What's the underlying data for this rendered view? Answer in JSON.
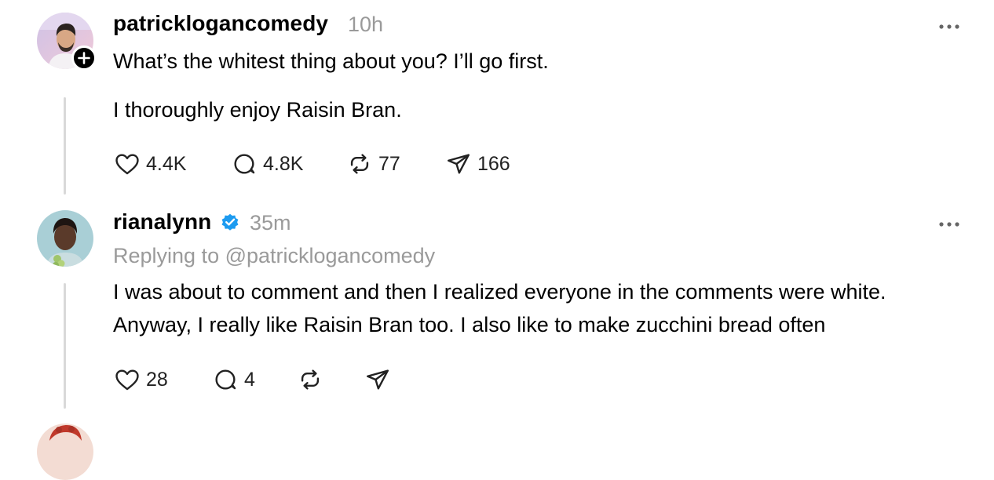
{
  "posts": [
    {
      "username": "patricklogancomedy",
      "time": "10h",
      "verified": false,
      "lines": [
        "What’s the whitest thing about you? I’ll go first.",
        "I thoroughly enjoy Raisin Bran."
      ],
      "actions": {
        "likes": "4.4K",
        "replies": "4.8K",
        "reposts": "77",
        "shares": "166"
      }
    },
    {
      "username": "rianalynn",
      "time": "35m",
      "verified": true,
      "reply_to": "Replying to @patricklogancomedy",
      "lines": [
        "I was about to comment and then I realized everyone in the comments were white.",
        "Anyway, I really like Raisin Bran too. I also like to make zucchini bread often"
      ],
      "actions": {
        "likes": "28",
        "replies": "4",
        "reposts": "",
        "shares": ""
      }
    }
  ],
  "colors": {
    "text": "#000000",
    "muted": "#9a9a9a",
    "verified": "#1d9bf0",
    "thread_line": "#d9d9d9"
  },
  "icons": {
    "like": "heart-icon",
    "reply": "comment-bubble-icon",
    "repost": "repost-arrows-icon",
    "share": "paper-plane-icon",
    "more": "more-dots-icon",
    "follow": "plus-icon",
    "verified": "verified-badge-icon"
  }
}
